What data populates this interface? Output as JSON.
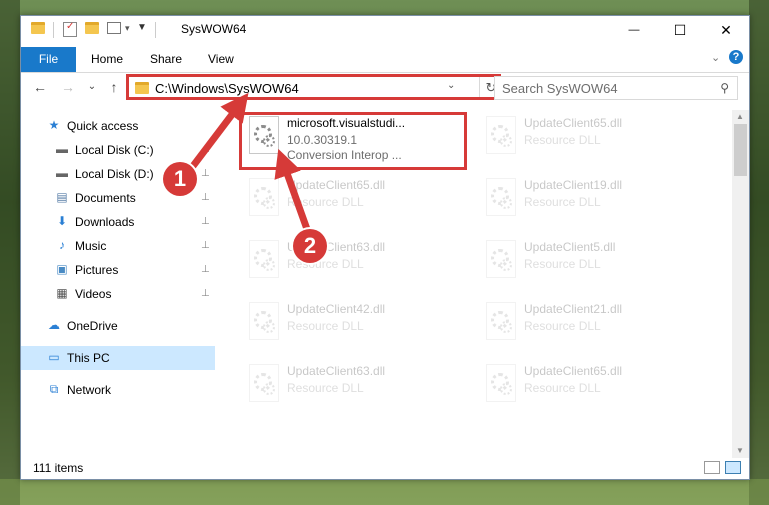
{
  "window": {
    "title": "SysWOW64",
    "minimize": "—",
    "maximize": "☐",
    "close": "✕"
  },
  "ribbon": {
    "tabs": [
      "File",
      "Home",
      "Share",
      "View"
    ],
    "help": "?",
    "expand": "⌄"
  },
  "nav": {
    "back": "←",
    "forward": "→",
    "recent": "⌄",
    "up": "↑",
    "address": "C:\\Windows\\SysWOW64",
    "address_dropdown": "⌄",
    "refresh": "↻",
    "search_placeholder": "Search SysWOW64",
    "search_icon": "⚲"
  },
  "sidebar": {
    "items": [
      {
        "label": "Quick access",
        "icon": "star-icon",
        "glyph": "★"
      },
      {
        "label": "Local Disk (C:)",
        "icon": "drive-icon",
        "glyph": "▬"
      },
      {
        "label": "Local Disk (D:)",
        "icon": "drive-icon",
        "glyph": "▬"
      },
      {
        "label": "Documents",
        "icon": "documents-icon",
        "glyph": "▤"
      },
      {
        "label": "Downloads",
        "icon": "downloads-icon",
        "glyph": "⬇"
      },
      {
        "label": "Music",
        "icon": "music-icon",
        "glyph": "♪"
      },
      {
        "label": "Pictures",
        "icon": "pictures-icon",
        "glyph": "▣"
      },
      {
        "label": "Videos",
        "icon": "videos-icon",
        "glyph": "▦"
      },
      {
        "label": "OneDrive",
        "icon": "cloud-icon",
        "glyph": "☁"
      },
      {
        "label": "This PC",
        "icon": "computer-icon",
        "glyph": "▭"
      },
      {
        "label": "Network",
        "icon": "network-icon",
        "glyph": "⧉"
      }
    ],
    "pin": "📌"
  },
  "files": {
    "highlighted": {
      "name": "microsoft.visualstudi...",
      "version": "10.0.30319.1",
      "description": "Conversion Interop ..."
    },
    "faded": [
      {
        "name": "UpdateClient65.dll",
        "type": "Resource DLL"
      },
      {
        "name": "UpdateClient65.dll",
        "type": "Resource DLL"
      },
      {
        "name": "UpdateClient19.dll",
        "type": "Resource DLL"
      },
      {
        "name": "UpdateClient63.dll",
        "type": "Resource DLL"
      },
      {
        "name": "UpdateClient5.dll",
        "type": "Resource DLL"
      },
      {
        "name": "UpdateClient42.dll",
        "type": "Resource DLL"
      },
      {
        "name": "UpdateClient21.dll",
        "type": "Resource DLL"
      },
      {
        "name": "UpdateClient63.dll",
        "type": "Resource DLL"
      },
      {
        "name": "UpdateClient65.dll",
        "type": "Resource DLL"
      }
    ]
  },
  "status": {
    "count": "111 items"
  },
  "callouts": [
    "1",
    "2"
  ],
  "colors": {
    "accent": "#1979ca",
    "highlight": "#d63a38",
    "selected": "#cce8ff"
  }
}
